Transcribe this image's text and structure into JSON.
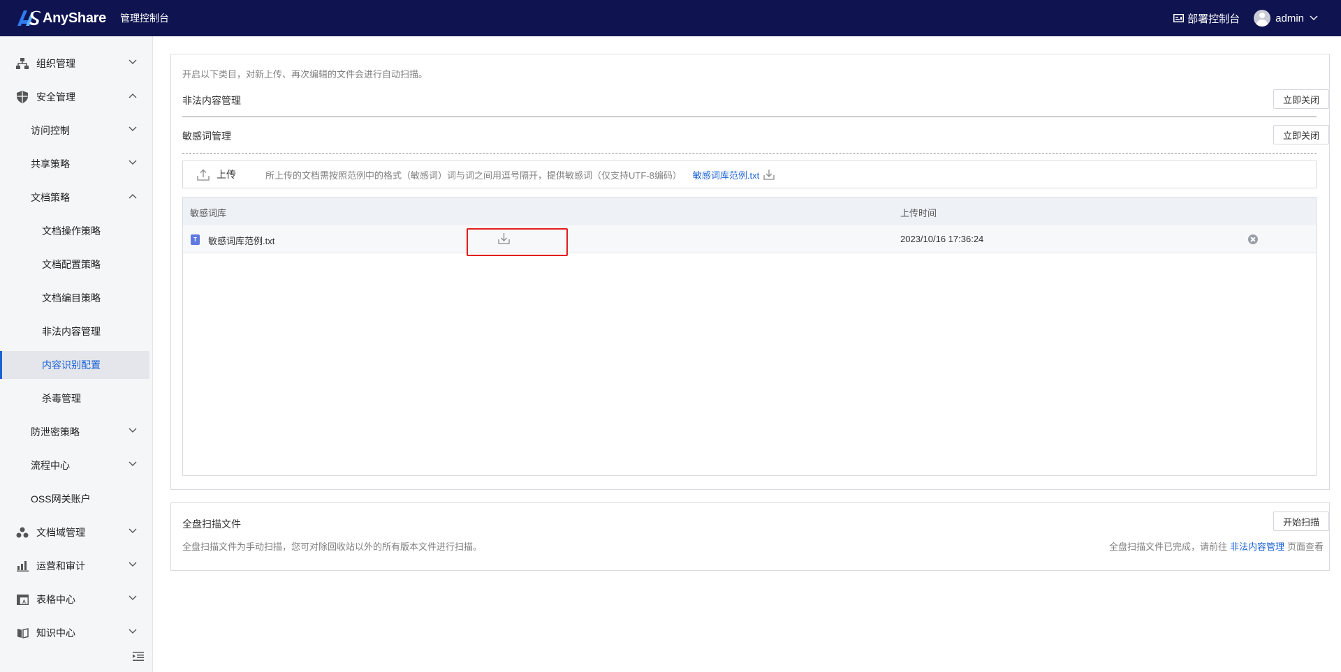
{
  "header": {
    "logo_text": "AnyShare",
    "console_title": "管理控制台",
    "deploy_console": "部署控制台",
    "username": "admin"
  },
  "sidebar": {
    "items": [
      {
        "label": "组织管理",
        "icon": "org-structure-icon",
        "expanded": false
      },
      {
        "label": "安全管理",
        "icon": "shield-icon",
        "expanded": true
      },
      {
        "label": "访问控制",
        "expanded": false
      },
      {
        "label": "共享策略",
        "expanded": false
      },
      {
        "label": "文档策略",
        "expanded": true
      },
      {
        "label": "文档操作策略"
      },
      {
        "label": "文档配置策略"
      },
      {
        "label": "文档编目策略"
      },
      {
        "label": "非法内容管理"
      },
      {
        "label": "内容识别配置",
        "active": true
      },
      {
        "label": "杀毒管理"
      },
      {
        "label": "防泄密策略",
        "expanded": false
      },
      {
        "label": "流程中心",
        "expanded": false
      },
      {
        "label": "OSS网关账户"
      },
      {
        "label": "文档域管理",
        "icon": "doc-domain-icon",
        "expanded": false
      },
      {
        "label": "运营和审计",
        "icon": "bar-chart-icon",
        "expanded": false
      },
      {
        "label": "表格中心",
        "icon": "table-icon",
        "expanded": false
      },
      {
        "label": "知识中心",
        "icon": "book-icon",
        "expanded": false
      }
    ]
  },
  "content": {
    "description": "开启以下类目，对新上传、再次编辑的文件会进行自动扫描。",
    "illegal_content": {
      "title": "非法内容管理",
      "button": "立即关闭"
    },
    "sensitive_words": {
      "title": "敏感词管理",
      "button": "立即关闭"
    },
    "upload": {
      "label": "上传",
      "hint": "所上传的文档需按照范例中的格式（敏感词）词与词之间用逗号隔开，提供敏感词（仅支持UTF-8编码）",
      "sample_link": "敏感词库范例.txt"
    },
    "table": {
      "columns": [
        "敏感词库",
        "上传时间"
      ],
      "rows": [
        {
          "file_icon_letter": "T",
          "name": "敏感词库范例.txt",
          "upload_time": "2023/10/16 17:36:24"
        }
      ]
    },
    "full_scan": {
      "title": "全盘扫描文件",
      "button": "开始扫描",
      "description": "全盘扫描文件为手动扫描，您可对除回收站以外的所有版本文件进行扫描。",
      "status_prefix": "全盘扫描文件已完成，请前往",
      "status_link": "非法内容管理",
      "status_suffix": "页面查看"
    }
  },
  "colors": {
    "topbar": "#0f1450",
    "accent": "#1a62d6",
    "highlight": "#e31c1c"
  }
}
